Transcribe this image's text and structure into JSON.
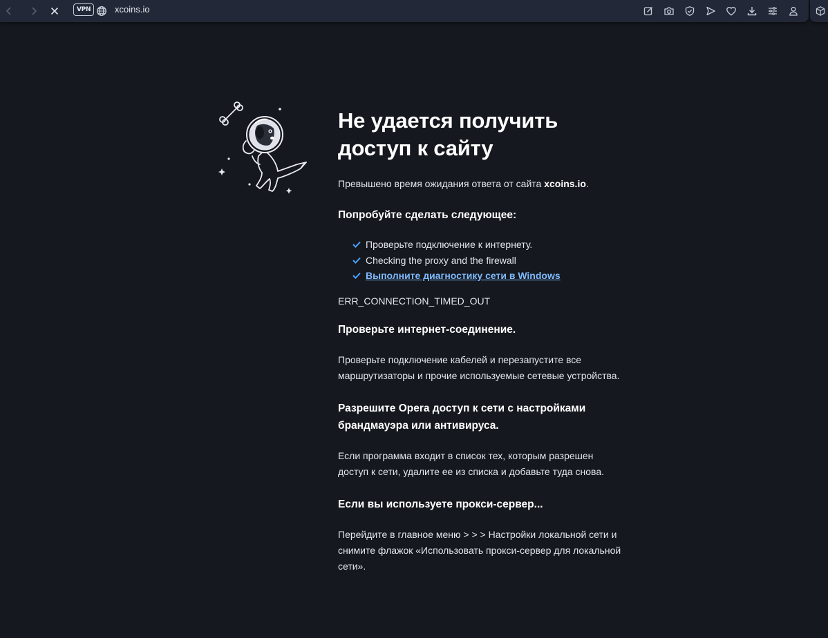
{
  "browser": {
    "vpn_label": "VPN",
    "url": "xcoins.io",
    "icons": [
      "back-icon",
      "forward-icon",
      "stop-icon",
      "globe-icon",
      "edit-icon",
      "camera-icon",
      "shield-check-icon",
      "send-icon",
      "heart-icon",
      "download-icon",
      "easy-setup-icon",
      "profile-icon",
      "extension-cube-icon"
    ]
  },
  "error": {
    "title": "Не удается получить доступ к сайту",
    "message_prefix": "Превышено время ожидания ответа от сайта ",
    "message_site": "xcoins.io",
    "message_suffix": ".",
    "try_heading": "Попробуйте сделать следующее:",
    "suggestions": [
      "Проверьте подключение к интернету.",
      "Checking the proxy and the firewall",
      "Выполните диагностику сети в Windows"
    ],
    "code": "ERR_CONNECTION_TIMED_OUT",
    "section1_heading": "Проверьте интернет-соединение.",
    "section1_text": "Проверьте подключение кабелей и перезапустите все маршрутизаторы и прочие используемые сетевые устройства.",
    "section2_heading": "Разрешите Opera доступ к сети с настройками брандмауэра или антивируса.",
    "section2_text": "Если программа входит в список тех, которым разрешен доступ к сети, удалите ее из списка и добавьте туда снова.",
    "section3_heading": "Если вы используете прокси-сервер...",
    "section3_text": "Перейдите в главное меню > > > Настройки локальной сети и снимите флажок «Использовать прокси-сервер для локальной сети»."
  },
  "colors": {
    "background": "#15181e",
    "toolbar": "#232838",
    "link": "#7fbbff",
    "check": "#4aa3ff"
  }
}
